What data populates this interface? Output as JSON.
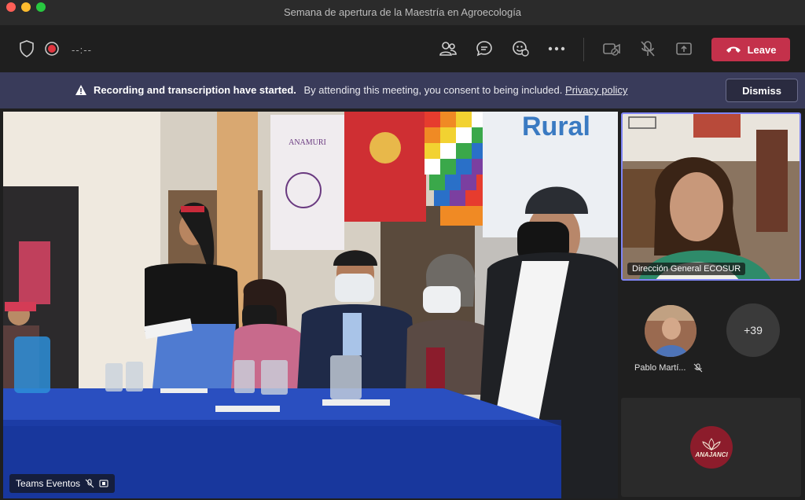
{
  "window": {
    "title": "Semana de apertura de la Maestría en Agroecología"
  },
  "toolbar": {
    "timer": "--:--",
    "leave_label": "Leave",
    "icons": [
      "shield-icon",
      "record-icon",
      "people-icon",
      "chat-icon",
      "react-icon",
      "more-icon",
      "camera-off-icon",
      "mic-off-icon",
      "share-icon"
    ]
  },
  "banner": {
    "title": "Recording and transcription have started.",
    "message": "By attending this meeting, you consent to being included.",
    "link": "Privacy policy",
    "dismiss_label": "Dismiss"
  },
  "main_video": {
    "label": "Teams Eventos",
    "banner_text_1": "ANAMURI",
    "banner_text_2": "Rural"
  },
  "participants": {
    "active_speaker": "Dirección General ECOSUR",
    "pablo": "Pablo Martí...",
    "more_count": "+39",
    "logo_text": "ANAJANCI"
  },
  "colors": {
    "leave": "#c4314b",
    "banner_bg": "#393b5a",
    "active_border": "#7f85f5"
  }
}
